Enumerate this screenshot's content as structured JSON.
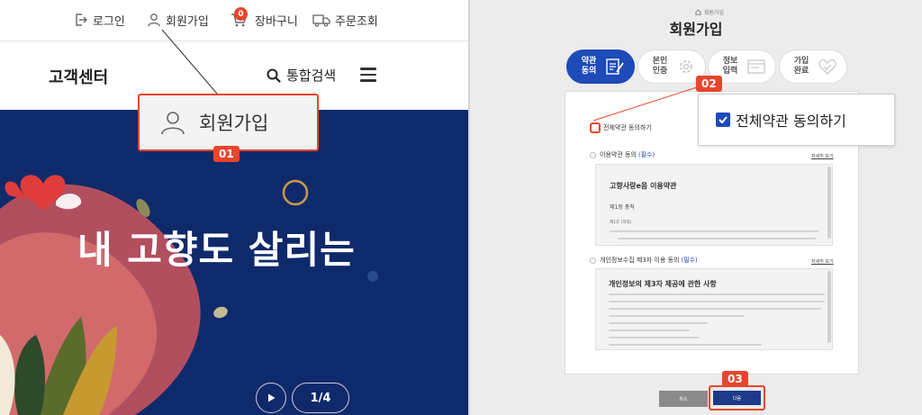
{
  "left": {
    "topnav": {
      "login": "로그인",
      "signup": "회원가입",
      "cart": "장바구니",
      "cart_count": "0",
      "orders": "주문조회"
    },
    "header": {
      "logo": "고객센터",
      "search": "통합검색"
    },
    "banner": {
      "title": "내 고향도 살리는",
      "pager": "1/4"
    },
    "zoom": {
      "label": "회원가입",
      "step": "01"
    }
  },
  "right": {
    "breadcrumb": "회원가입",
    "title": "회원가입",
    "steps": [
      {
        "label": "약관\n동의",
        "active": true
      },
      {
        "label": "본인\n인증",
        "active": false
      },
      {
        "label": "정보\n입력",
        "active": false
      },
      {
        "label": "가입\n완료",
        "active": false
      }
    ],
    "step_badge_02": "02",
    "step_badge_03": "03",
    "agree_all": "전체약관 동의하기",
    "popup_label": "전체약관 동의하기",
    "terms": {
      "label": "이용약관 동의",
      "required": "(필수)",
      "view_all": "자세히 보기",
      "doc_title": "고향사랑e음 이용약관",
      "chapter": "제1장 총칙",
      "article": "제1조 (목적)"
    },
    "privacy": {
      "label": "개인정보수집 제3자 이용 동의",
      "required": "(필수)",
      "view_all": "자세히 보기",
      "doc_title": "개인정보의 제3자 제공에 관한 사항"
    },
    "buttons": {
      "cancel": "취소",
      "next": "다음"
    },
    "colors": {
      "accent": "#1e4bb8",
      "highlight": "#e8452c",
      "banner": "#0f2a6b"
    }
  }
}
